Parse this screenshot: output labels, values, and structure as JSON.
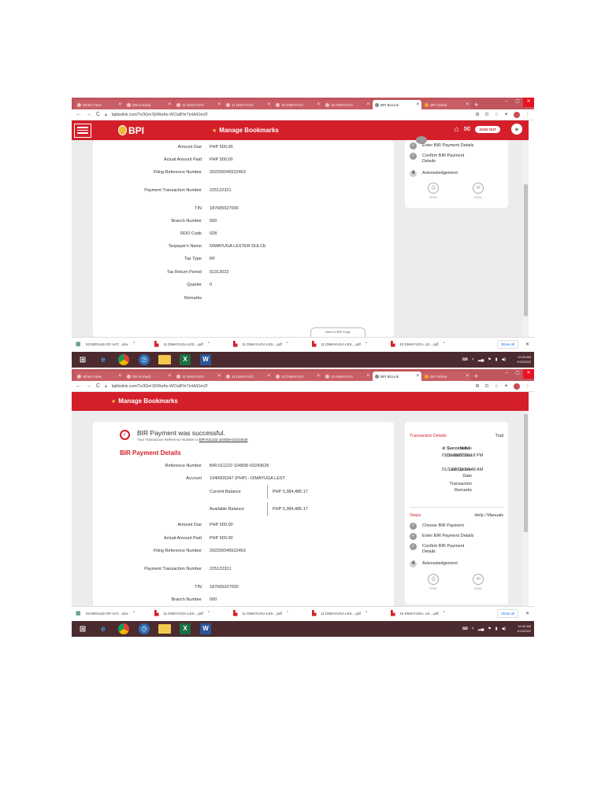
{
  "browser": {
    "tabs": [
      {
        "title": "What's New",
        "active": false,
        "orange": false
      },
      {
        "title": "(58 unread) -",
        "active": false,
        "orange": false
      },
      {
        "title": "11 DIMAYUGi",
        "active": false,
        "orange": false
      },
      {
        "title": "11 DIMAYUGi",
        "active": false,
        "orange": false
      },
      {
        "title": "10 DIMAYUGi",
        "active": false,
        "orange": false
      },
      {
        "title": "10 DIMAYUGi",
        "active": false,
        "orange": false
      },
      {
        "title": "BPI BizLink",
        "active": true,
        "orange": false
      },
      {
        "title": "BPI Online",
        "active": false,
        "orange": true
      }
    ],
    "tab_close": "×",
    "new_tab": "+",
    "url": "bpibizlink.com/?o/3Gm7jKRtoAo-WCIaBYeTmIA/iGm2f",
    "win_min": "–",
    "win_max": "▢",
    "win_close": "✕"
  },
  "header": {
    "logo_text": "BPI",
    "title": "Manage Bookmarks",
    "signout": "SIGN OUT"
  },
  "top_details": [
    {
      "label": "Amount Due",
      "value": "PHP 500.00"
    },
    {
      "label": "Actual Amount Paid",
      "value": "PHP 500.00"
    },
    {
      "label": "Filing Reference Number",
      "value": "292200045522463"
    },
    {
      "label": "Payment Transaction Number",
      "value": "225122321"
    },
    {
      "label": "TIN",
      "value": "187665027000"
    },
    {
      "label": "Branch Number",
      "value": "000"
    },
    {
      "label": "RDO Code",
      "value": "028"
    },
    {
      "label": "Taxpayer's Name",
      "value": "DIMAYUGA LESTER DULCE"
    },
    {
      "label": "Tax Type",
      "value": "RF"
    },
    {
      "label": "Tax Return Period",
      "value": "01312022"
    },
    {
      "label": "Quarter",
      "value": "0"
    },
    {
      "label": "Remarks",
      "value": ""
    }
  ],
  "top_button_partial": "Back to BIR Page",
  "steps_top": [
    {
      "text": "Enter BIR Payment Details",
      "type": "check"
    },
    {
      "text": "Confirm BIR Payment Details",
      "type": "check"
    },
    {
      "text": "Acknowledgement",
      "type": "num",
      "num": "4"
    }
  ],
  "actions": {
    "print": "PRINT",
    "email": "EMAIL"
  },
  "success": {
    "title": "BIR Payment was successful.",
    "sub_prefix": "Your Transaction Reference Number is",
    "ref": "BIR-011222-104836-03243626"
  },
  "bir_section_title": "BIR Payment Details",
  "bottom_details": [
    {
      "label": "Reference Number",
      "value": "BIR-011222-104836-03243626"
    },
    {
      "label": "Account",
      "value": "1940005347 (PHP) - DIMAYUGA LEST"
    }
  ],
  "balances": [
    {
      "label": "Current Balance",
      "value": "PHP 5,384,485.17"
    },
    {
      "label": "Available Balance",
      "value": "PHP 5,384,485.17"
    }
  ],
  "bottom_details_2": [
    {
      "label": "Amount Due",
      "value": "PHP 500.00"
    },
    {
      "label": "Actual Amount Paid",
      "value": "PHP 500.00"
    },
    {
      "label": "Filing Reference Number",
      "value": "292200045522463"
    },
    {
      "label": "Payment Transaction Number",
      "value": "225122321"
    },
    {
      "label": "TIN",
      "value": "187665027000"
    },
    {
      "label": "Branch Number",
      "value": "000"
    }
  ],
  "transaction": {
    "title": "Transaction Details",
    "trail": "Trail",
    "rows": [
      {
        "k": "Status",
        "v": "Successful"
      },
      {
        "k": "Created Date",
        "v": "01/11/2022 02:18 PM"
      },
      {
        "k": "Last Update Date",
        "v": "01/12/2022 10:48 AM"
      },
      {
        "k": "Transaction Remarks",
        "v": ""
      }
    ]
  },
  "steps_section": {
    "title": "Steps",
    "help": "Help / Manuals",
    "items": [
      {
        "text": "Choose BIR Payment",
        "type": "check"
      },
      {
        "text": "Enter BIR Payment Details",
        "type": "check"
      },
      {
        "text": "Confirm BIR Payment Details",
        "type": "check"
      },
      {
        "text": "Acknowledgement",
        "type": "num",
        "num": "4"
      }
    ]
  },
  "downloads": [
    {
      "name": "SCHEDULE-OF-VAT....xlsx",
      "kind": "xls"
    },
    {
      "name": "11 DIMAYUGA LES....pdf",
      "kind": "pdf"
    },
    {
      "name": "11 DIMAYUGA LES....pdf",
      "kind": "pdf"
    },
    {
      "name": "11 DIMAYUGA LES....pdf",
      "kind": "pdf"
    },
    {
      "name": "10 DIMAYUGA, LE....pdf",
      "kind": "pdf"
    }
  ],
  "show_all": "Show all",
  "taskbar": {
    "time": "10:49 AM",
    "date": "1/12/2022"
  },
  "colors": {
    "brand_red": "#d41f2a",
    "tab_bar": "#c0565d",
    "taskbar": "#4b2b2f"
  }
}
